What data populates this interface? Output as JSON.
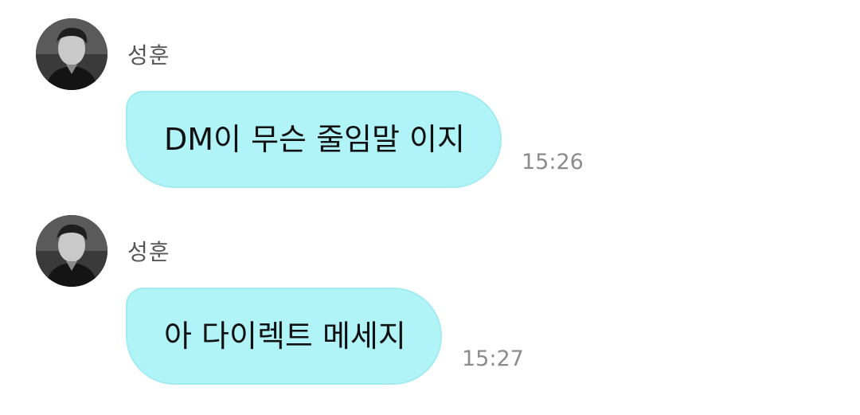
{
  "messages": [
    {
      "sender": "성훈",
      "avatar_icon": "profile-photo",
      "text": "DM이 무슨 줄임말 이지",
      "time": "15:26"
    },
    {
      "sender": "성훈",
      "avatar_icon": "profile-photo",
      "text": "아 다이렉트 메세지",
      "time": "15:27"
    }
  ],
  "colors": {
    "bubble": "#b0f4f7",
    "bubble_border": "#a2ecf1",
    "sender_text": "#555555",
    "time_text": "#8c8c8c",
    "background": "#ffffff"
  }
}
